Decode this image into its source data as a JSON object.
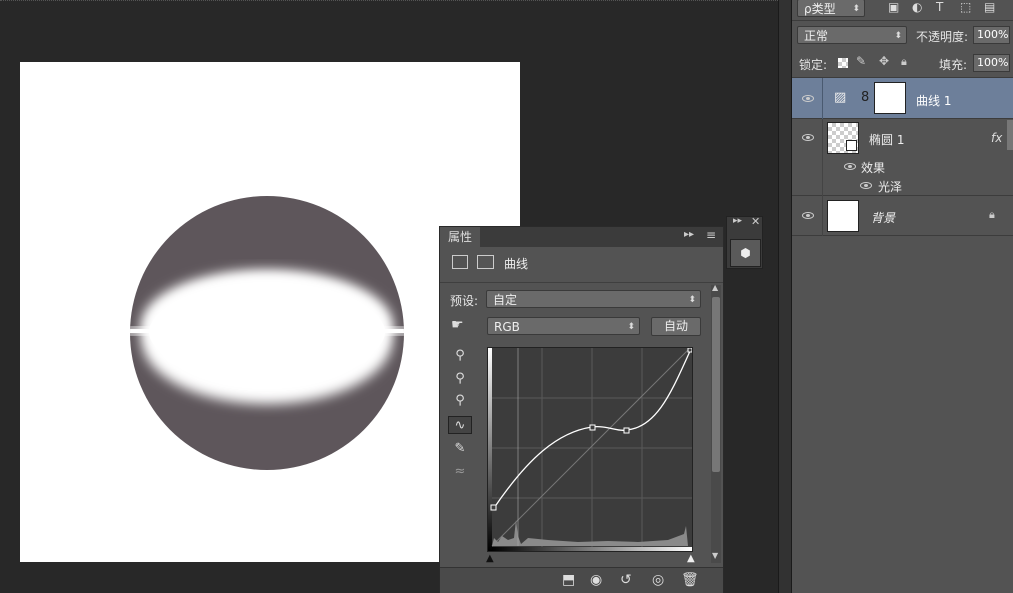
{
  "layers_panel": {
    "filter_kind_label": "ρ类型",
    "blend_mode": "正常",
    "opacity_label": "不透明度:",
    "opacity_value": "100%",
    "lock_label": "锁定:",
    "fill_label": "填充:",
    "fill_value": "100%",
    "layers": [
      {
        "name": "曲线 1",
        "selected": true
      },
      {
        "name": "椭圆 1",
        "fx": "fx",
        "effects_label": "效果",
        "effect_item": "光泽"
      },
      {
        "name": "背景",
        "locked": true
      }
    ]
  },
  "properties_panel": {
    "tab_label": "属性",
    "adjustment_title": "曲线",
    "preset_label": "预设:",
    "preset_value": "自定",
    "channel_value": "RGB",
    "auto_button": "自动"
  },
  "colors": {
    "shape_fill": "#5e565b",
    "selected_layer": "#6d7f9a",
    "panel_bg": "#535353"
  },
  "icons": [
    "eye-icon",
    "lock-icon",
    "fx-icon",
    "link-icon",
    "eyedropper-icon",
    "curve-icon",
    "pencil-icon",
    "smooth-icon",
    "clip-icon",
    "reset-icon",
    "visibility-icon",
    "trash-icon",
    "hand-icon",
    "cube-icon"
  ]
}
